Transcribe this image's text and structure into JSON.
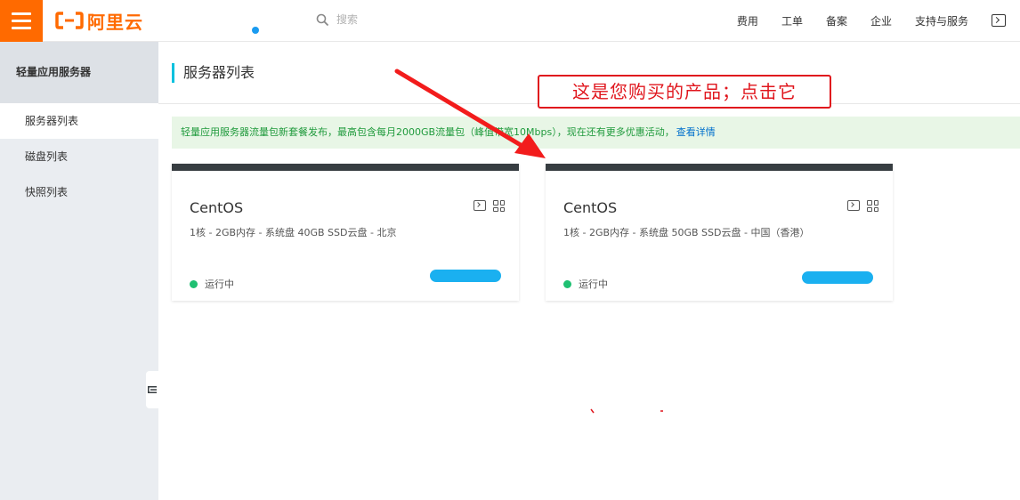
{
  "topbar": {
    "brand": "阿里云",
    "search_placeholder": "搜索",
    "nav": [
      "费用",
      "工单",
      "备案",
      "企业",
      "支持与服务"
    ],
    "brand_color": "#ff6a00"
  },
  "sidebar": {
    "title": "轻量应用服务器",
    "items": [
      {
        "label": "服务器列表",
        "active": true
      },
      {
        "label": "磁盘列表",
        "active": false
      },
      {
        "label": "快照列表",
        "active": false
      }
    ]
  },
  "main": {
    "title": "服务器列表",
    "notice": {
      "text": "轻量应用服务器流量包新套餐发布，最高包含每月2000GB流量包（峰值带宽10Mbps），现在还有更多优惠活动，",
      "link": "查看详情"
    },
    "servers": [
      {
        "os": "CentOS",
        "spec": "1核 - 2GB内存 - 系统盘 40GB SSD云盘 - 北京",
        "status": "运行中"
      },
      {
        "os": "CentOS",
        "spec": "1核 - 2GB内存 - 系统盘 50GB SSD云盘 - 中国（香港）",
        "status": "运行中"
      }
    ]
  },
  "annotation": {
    "text": "这是您购买的产品；点击它",
    "color": "#e0161d"
  }
}
